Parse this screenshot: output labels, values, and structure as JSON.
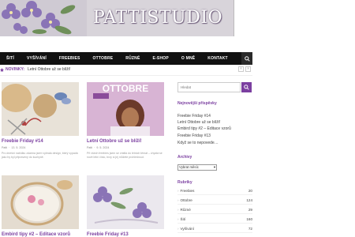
{
  "header": {
    "logo_text": "PATTISTUDIO"
  },
  "nav": {
    "items": [
      "ŠITÍ",
      "VYŠÍVÁNÍ",
      "FREEBIES",
      "OTTOBRE",
      "RŮZNÉ",
      "E-SHOP",
      "O MNĚ",
      "KONTAKT"
    ]
  },
  "ticker": {
    "label": "NOVINKY:",
    "text": "Letní Ottobre už se blíží!",
    "prev": "‹",
    "next": "›"
  },
  "posts": [
    {
      "title": "Freebie Friday #14",
      "author": "Patti",
      "date": "13. 5. 2024",
      "excerpt": "Pro dnešní nabídku zdarma jsem vybrala design, který vypadá jako by byl připravený do kuchyně."
    },
    {
      "title": "Letní Ottobre už se blíží!",
      "author": "Patti",
      "date": "9. 5. 2024",
      "excerpt": "Při všech freebies jsem se vrátila do letních témat – chystá se nové letní číslo, brzy si jej můžete prohlédnout."
    },
    {
      "title": "Embird tipy #2 – Editace vzorů"
    },
    {
      "title": "Freebie Friday #13"
    }
  ],
  "sidebar": {
    "search_placeholder": "Hledat",
    "recent_title": "Nejnovější příspěvky",
    "recent": [
      "Freebie Friday #14",
      "Letní Ottobre už se blíží!",
      "Embird tipy #2 – Editace vzorů",
      "Freebie Friday #13",
      "Když se to nepovede…"
    ],
    "archive_title": "Archivy",
    "archive_select": "Vybrat měsíc",
    "categories_title": "Rubriky",
    "categories": [
      {
        "name": "Freebies",
        "count": "20"
      },
      {
        "name": "Ottobre",
        "count": "124"
      },
      {
        "name": "Různé",
        "count": "29"
      },
      {
        "name": "Šití",
        "count": "160"
      },
      {
        "name": "Vyšívání",
        "count": "72"
      }
    ]
  },
  "colors": {
    "accent": "#7b3fa0",
    "nav_bg": "#111111"
  }
}
